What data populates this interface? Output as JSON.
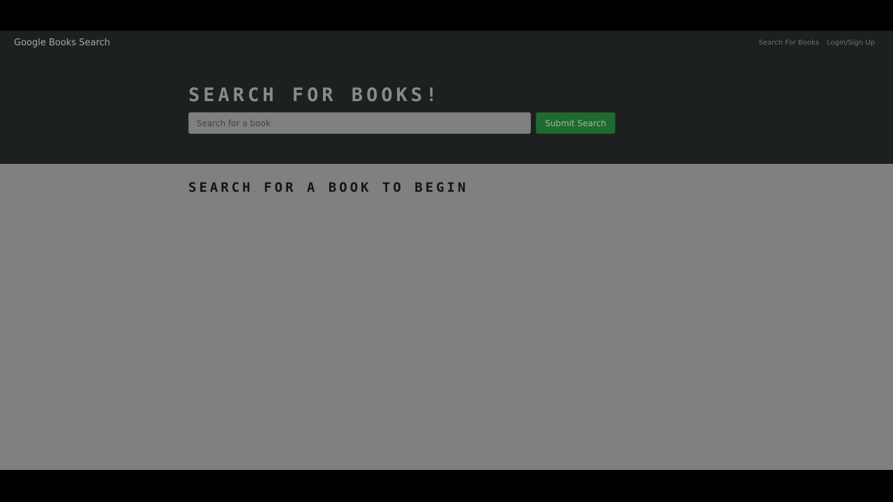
{
  "navbar": {
    "brand": "Google Books Search",
    "links": [
      {
        "label": "Search For Books"
      },
      {
        "label": "Login/Sign Up"
      }
    ]
  },
  "hero": {
    "title": "Search for Books!",
    "search": {
      "placeholder": "Search for a book",
      "value": ""
    },
    "submit_label": "Submit Search"
  },
  "results": {
    "heading": "Search for a book to begin"
  },
  "colors": {
    "navbar_bg": "#1d2021",
    "content_bg": "#808080",
    "accent_green": "#1f6b2e"
  }
}
